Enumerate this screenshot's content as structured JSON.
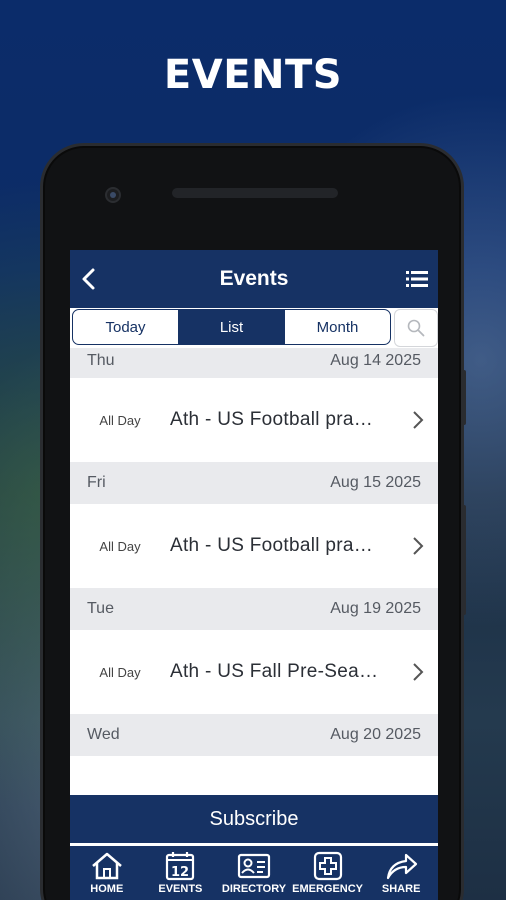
{
  "headline": "EVENTS",
  "appbar": {
    "title": "Events"
  },
  "segments": {
    "today": "Today",
    "list": "List",
    "month": "Month"
  },
  "days": [
    {
      "weekday": "Thu",
      "date": "Aug 14 2025",
      "event": {
        "time": "All Day",
        "name": "Ath - US Football pra…"
      }
    },
    {
      "weekday": "Fri",
      "date": "Aug 15 2025",
      "event": {
        "time": "All Day",
        "name": "Ath - US Football pra…"
      }
    },
    {
      "weekday": "Tue",
      "date": "Aug 19 2025",
      "event": {
        "time": "All Day",
        "name": "Ath - US Fall Pre-Sea…"
      }
    },
    {
      "weekday": "Wed",
      "date": "Aug 20 2025"
    }
  ],
  "subscribe_label": "Subscribe",
  "tabbar": {
    "home": "HOME",
    "events": "EVENTS",
    "events_icon_number": "12",
    "directory": "DIRECTORY",
    "emergency": "EMERGENCY",
    "share": "SHARE"
  },
  "colors": {
    "primary": "#163264",
    "date_row_bg": "#e9eaed"
  }
}
